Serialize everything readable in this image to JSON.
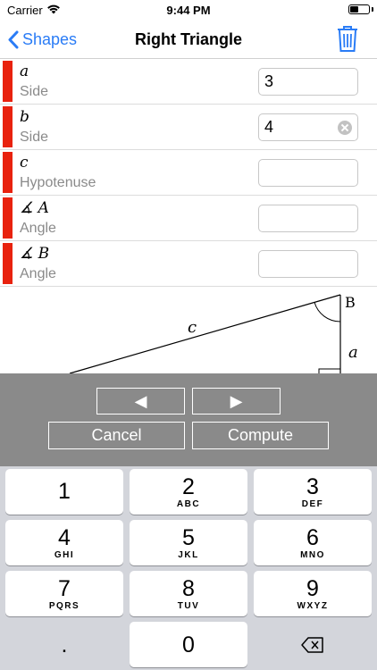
{
  "status_bar": {
    "carrier": "Carrier",
    "time": "9:44 PM"
  },
  "nav": {
    "back_label": "Shapes",
    "title": "Right Triangle"
  },
  "rows": [
    {
      "symbol": "a",
      "label": "Side",
      "value": "3",
      "clearable": false
    },
    {
      "symbol": "b",
      "label": "Side",
      "value": "4",
      "clearable": true
    },
    {
      "symbol": "c",
      "label": "Hypotenuse",
      "value": "",
      "clearable": false
    },
    {
      "symbol": "∡ A",
      "label": "Angle",
      "value": "",
      "clearable": false
    },
    {
      "symbol": "∡ B",
      "label": "Angle",
      "value": "",
      "clearable": false
    }
  ],
  "diagram": {
    "label_c": "c",
    "label_b": "B",
    "label_a": "a"
  },
  "panel": {
    "prev_label": "◀",
    "next_label": "▶",
    "cancel_label": "Cancel",
    "compute_label": "Compute"
  },
  "keyboard": {
    "keys": [
      {
        "num": "1",
        "letters": ""
      },
      {
        "num": "2",
        "letters": "ABC"
      },
      {
        "num": "3",
        "letters": "DEF"
      },
      {
        "num": "4",
        "letters": "GHI"
      },
      {
        "num": "5",
        "letters": "JKL"
      },
      {
        "num": "6",
        "letters": "MNO"
      },
      {
        "num": "7",
        "letters": "PQRS"
      },
      {
        "num": "8",
        "letters": "TUV"
      },
      {
        "num": "9",
        "letters": "WXYZ"
      }
    ],
    "decimal": ".",
    "zero": "0",
    "delete_icon": "backspace-icon"
  },
  "colors": {
    "accent": "#2a7cf6",
    "marker": "#e8220e",
    "panel": "#8a8a8a",
    "keyboard_bg": "#d3d5db"
  }
}
